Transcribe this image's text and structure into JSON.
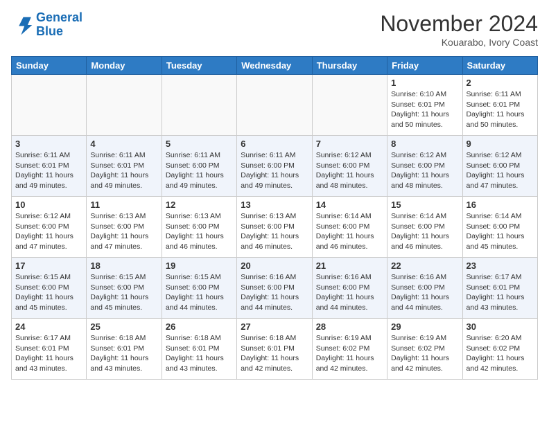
{
  "header": {
    "logo_line1": "General",
    "logo_line2": "Blue",
    "month": "November 2024",
    "location": "Kouarabo, Ivory Coast"
  },
  "weekdays": [
    "Sunday",
    "Monday",
    "Tuesday",
    "Wednesday",
    "Thursday",
    "Friday",
    "Saturday"
  ],
  "weeks": [
    [
      {
        "day": "",
        "info": ""
      },
      {
        "day": "",
        "info": ""
      },
      {
        "day": "",
        "info": ""
      },
      {
        "day": "",
        "info": ""
      },
      {
        "day": "",
        "info": ""
      },
      {
        "day": "1",
        "info": "Sunrise: 6:10 AM\nSunset: 6:01 PM\nDaylight: 11 hours\nand 50 minutes."
      },
      {
        "day": "2",
        "info": "Sunrise: 6:11 AM\nSunset: 6:01 PM\nDaylight: 11 hours\nand 50 minutes."
      }
    ],
    [
      {
        "day": "3",
        "info": "Sunrise: 6:11 AM\nSunset: 6:01 PM\nDaylight: 11 hours\nand 49 minutes."
      },
      {
        "day": "4",
        "info": "Sunrise: 6:11 AM\nSunset: 6:01 PM\nDaylight: 11 hours\nand 49 minutes."
      },
      {
        "day": "5",
        "info": "Sunrise: 6:11 AM\nSunset: 6:00 PM\nDaylight: 11 hours\nand 49 minutes."
      },
      {
        "day": "6",
        "info": "Sunrise: 6:11 AM\nSunset: 6:00 PM\nDaylight: 11 hours\nand 49 minutes."
      },
      {
        "day": "7",
        "info": "Sunrise: 6:12 AM\nSunset: 6:00 PM\nDaylight: 11 hours\nand 48 minutes."
      },
      {
        "day": "8",
        "info": "Sunrise: 6:12 AM\nSunset: 6:00 PM\nDaylight: 11 hours\nand 48 minutes."
      },
      {
        "day": "9",
        "info": "Sunrise: 6:12 AM\nSunset: 6:00 PM\nDaylight: 11 hours\nand 47 minutes."
      }
    ],
    [
      {
        "day": "10",
        "info": "Sunrise: 6:12 AM\nSunset: 6:00 PM\nDaylight: 11 hours\nand 47 minutes."
      },
      {
        "day": "11",
        "info": "Sunrise: 6:13 AM\nSunset: 6:00 PM\nDaylight: 11 hours\nand 47 minutes."
      },
      {
        "day": "12",
        "info": "Sunrise: 6:13 AM\nSunset: 6:00 PM\nDaylight: 11 hours\nand 46 minutes."
      },
      {
        "day": "13",
        "info": "Sunrise: 6:13 AM\nSunset: 6:00 PM\nDaylight: 11 hours\nand 46 minutes."
      },
      {
        "day": "14",
        "info": "Sunrise: 6:14 AM\nSunset: 6:00 PM\nDaylight: 11 hours\nand 46 minutes."
      },
      {
        "day": "15",
        "info": "Sunrise: 6:14 AM\nSunset: 6:00 PM\nDaylight: 11 hours\nand 46 minutes."
      },
      {
        "day": "16",
        "info": "Sunrise: 6:14 AM\nSunset: 6:00 PM\nDaylight: 11 hours\nand 45 minutes."
      }
    ],
    [
      {
        "day": "17",
        "info": "Sunrise: 6:15 AM\nSunset: 6:00 PM\nDaylight: 11 hours\nand 45 minutes."
      },
      {
        "day": "18",
        "info": "Sunrise: 6:15 AM\nSunset: 6:00 PM\nDaylight: 11 hours\nand 45 minutes."
      },
      {
        "day": "19",
        "info": "Sunrise: 6:15 AM\nSunset: 6:00 PM\nDaylight: 11 hours\nand 44 minutes."
      },
      {
        "day": "20",
        "info": "Sunrise: 6:16 AM\nSunset: 6:00 PM\nDaylight: 11 hours\nand 44 minutes."
      },
      {
        "day": "21",
        "info": "Sunrise: 6:16 AM\nSunset: 6:00 PM\nDaylight: 11 hours\nand 44 minutes."
      },
      {
        "day": "22",
        "info": "Sunrise: 6:16 AM\nSunset: 6:00 PM\nDaylight: 11 hours\nand 44 minutes."
      },
      {
        "day": "23",
        "info": "Sunrise: 6:17 AM\nSunset: 6:01 PM\nDaylight: 11 hours\nand 43 minutes."
      }
    ],
    [
      {
        "day": "24",
        "info": "Sunrise: 6:17 AM\nSunset: 6:01 PM\nDaylight: 11 hours\nand 43 minutes."
      },
      {
        "day": "25",
        "info": "Sunrise: 6:18 AM\nSunset: 6:01 PM\nDaylight: 11 hours\nand 43 minutes."
      },
      {
        "day": "26",
        "info": "Sunrise: 6:18 AM\nSunset: 6:01 PM\nDaylight: 11 hours\nand 43 minutes."
      },
      {
        "day": "27",
        "info": "Sunrise: 6:18 AM\nSunset: 6:01 PM\nDaylight: 11 hours\nand 42 minutes."
      },
      {
        "day": "28",
        "info": "Sunrise: 6:19 AM\nSunset: 6:02 PM\nDaylight: 11 hours\nand 42 minutes."
      },
      {
        "day": "29",
        "info": "Sunrise: 6:19 AM\nSunset: 6:02 PM\nDaylight: 11 hours\nand 42 minutes."
      },
      {
        "day": "30",
        "info": "Sunrise: 6:20 AM\nSunset: 6:02 PM\nDaylight: 11 hours\nand 42 minutes."
      }
    ]
  ]
}
